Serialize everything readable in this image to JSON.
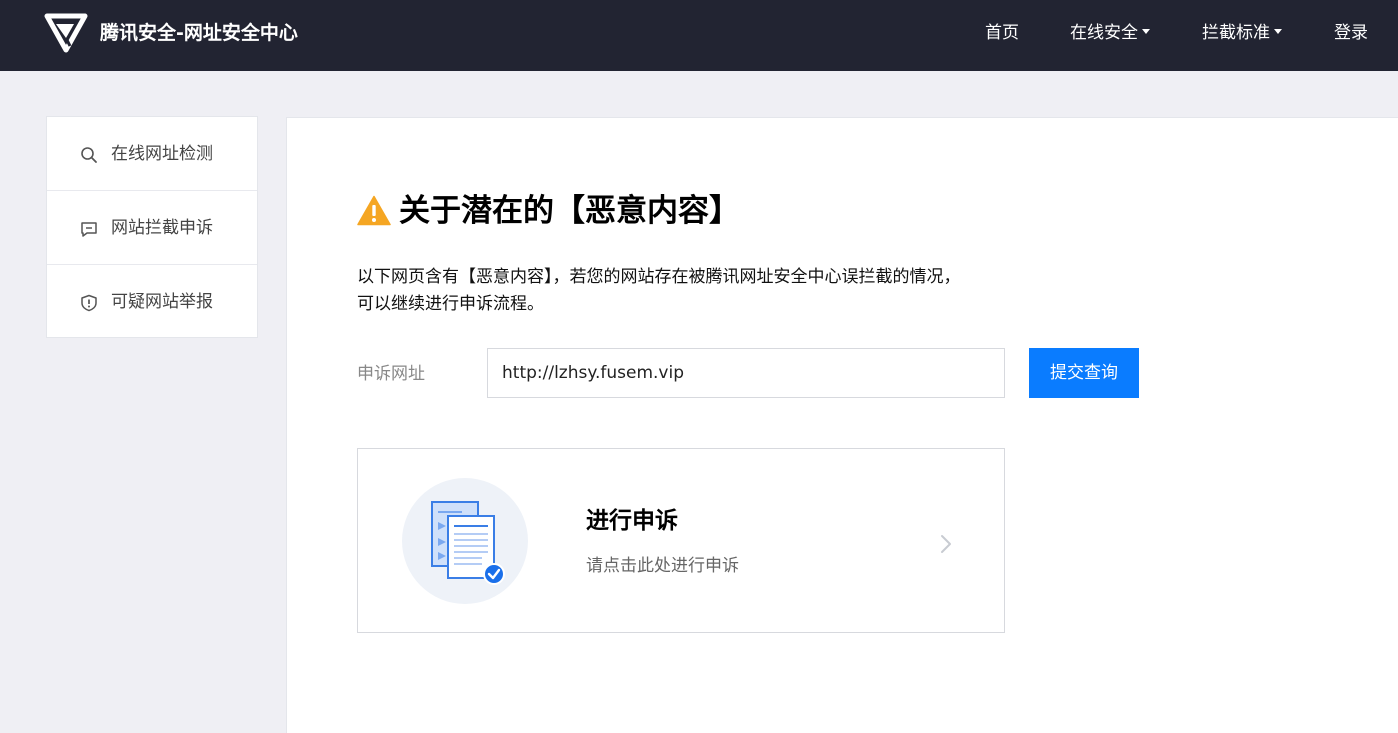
{
  "header": {
    "brand": "腾讯安全-网址安全中心",
    "nav": {
      "home": "首页",
      "online_security": "在线安全",
      "block_standard": "拦截标准",
      "login": "登录"
    }
  },
  "sidebar": {
    "items": [
      {
        "label": "在线网址检测",
        "icon": "search-icon"
      },
      {
        "label": "网站拦截申诉",
        "icon": "message-icon"
      },
      {
        "label": "可疑网站举报",
        "icon": "shield-icon"
      }
    ]
  },
  "main": {
    "title": "关于潜在的【恶意内容】",
    "desc_line1": "以下网页含有【恶意内容】，若您的网站存在被腾讯网址安全中心误拦截的情况，",
    "desc_line2": "可以继续进行申诉流程。",
    "url_label": "申诉网址",
    "url_value": "http://lzhsy.fusem.vip",
    "submit_label": "提交查询",
    "appeal": {
      "title": "进行申诉",
      "subtitle": "请点击此处进行申诉"
    }
  },
  "colors": {
    "header_bg": "#222432",
    "accent": "#0a7cff",
    "warning": "#f5a623",
    "page_bg": "#efeff4"
  }
}
